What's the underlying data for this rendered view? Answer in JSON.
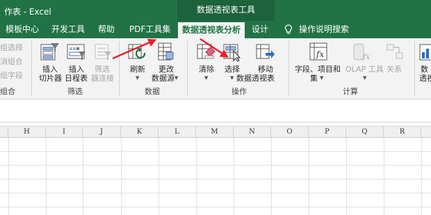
{
  "titlebar": {
    "title": "作表 - Excel",
    "contextual_group": "数据透视表工具"
  },
  "tabs": [
    {
      "id": "template",
      "label": "模板中心"
    },
    {
      "id": "developer",
      "label": "开发工具"
    },
    {
      "id": "help",
      "label": "帮助"
    },
    {
      "id": "pdf",
      "label": "PDF工具集"
    },
    {
      "id": "analyze",
      "label": "数据透视表分析",
      "active": true
    },
    {
      "id": "design",
      "label": "设计"
    },
    {
      "id": "tellme",
      "label": "操作说明搜索"
    }
  ],
  "ribbon": {
    "partial_left": {
      "items": [
        "组选择",
        "消组合",
        "组字段"
      ],
      "label": "组合"
    },
    "filter_group": {
      "label": "筛选",
      "insert_slicer": [
        "插入",
        "切片器"
      ],
      "insert_timeline": [
        "插入",
        "日程表"
      ],
      "filter_connections": [
        "筛选",
        "器连接"
      ]
    },
    "data_group": {
      "label": "数据",
      "refresh": "刷新",
      "change_source": [
        "更改",
        "数据源"
      ]
    },
    "actions_group": {
      "label": "操作",
      "clear": "清除",
      "select": "选择",
      "move": [
        "移动",
        "数据透视表"
      ]
    },
    "calc_group": {
      "label": "计算",
      "fields_items": [
        "字段、项目和",
        "集"
      ],
      "olap_tools": "OLAP 工具",
      "relationships": "关系"
    },
    "partial_right": {
      "lines": [
        "数",
        "透视"
      ]
    }
  },
  "grid": {
    "columns": [
      "H",
      "I",
      "J",
      "K",
      "L",
      "M",
      "N",
      "O",
      "P",
      "Q",
      "R"
    ]
  },
  "colors": {
    "excel_green": "#217346",
    "arrow_red": "#e8202a"
  }
}
